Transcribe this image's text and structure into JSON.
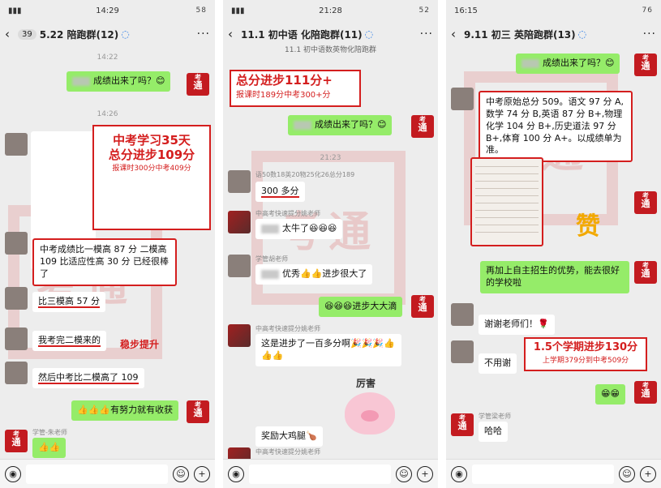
{
  "phones": [
    {
      "status": {
        "time": "14:29",
        "icons": "5G ▮▮ ◔",
        "battery": "58"
      },
      "nav": {
        "badge": "39",
        "title": "5.22 陪跑群(12)"
      },
      "timestamps": [
        "14:22",
        "14:26"
      ],
      "messages": {
        "m1": "成绩出来了吗？😊",
        "m2": "中考成绩比一模高 87 分 二模高 109 比适应性高 30 分 已经很棒了",
        "m3": "比三模高 57 分",
        "m4": "我考完二模来的",
        "m5": "然后中考比二模高了 109",
        "m6": "👍👍👍有努力就有收获",
        "m7": "👍👍"
      },
      "callout": {
        "line1": "中考学习35天",
        "line2": "总分进步109分",
        "line3": "报课时300分中考409分"
      },
      "tag": "稳步提升",
      "sender_label": "学管-朱老师",
      "watermark": "考通"
    },
    {
      "status": {
        "time": "21:28",
        "icons": "5G ▮▮ ◔",
        "battery": "52"
      },
      "nav": {
        "title": "11.1 初中语 化陪跑群(11)",
        "subtitle": "11.1 初中语数英物化陪跑群"
      },
      "timestamps": [
        "21:23"
      ],
      "callout": {
        "line1": "总分进步111分+",
        "line2": "报课时189分中考300+分"
      },
      "messages": {
        "m1": "成绩出来了吗？😊",
        "m2": "语50数18英20物25化26总分189",
        "m3": "300 多分",
        "m4": "太牛了😆😆😆",
        "m5": "优秀👍👍进步很大了",
        "m6": "😆😆😆进步大大滴",
        "m7": "这是进步了一百多分啊🎉🎉🎉👍👍👍",
        "m8": "奖励大鸡腿🍗"
      },
      "senders": [
        "中高考快速提分姚老师",
        "学管胡老师",
        "中高考快速提分姚老师",
        "中高考快速提分姚老师"
      ],
      "sticker_text": "厉害",
      "watermark": "考通"
    },
    {
      "status": {
        "time": "16:15",
        "icons": "0.90 KB/s ▮▮ 76%",
        "battery": "76"
      },
      "nav": {
        "title": "9.11 初三 英陪跑群(13)"
      },
      "messages": {
        "m1": "成绩出来了吗？😊",
        "m2": "中考原始总分 509。语文 97 分 A,数学 74 分 B,英语 87 分 B+,物理化学 104 分 B+,历史道法 97 分 B+,体育 100 分 A+。以成绩单为准。",
        "m3": "再加上自主招生的优势，能去很好的学校啦",
        "m4": "谢谢老师们！🌹",
        "m5": "不用谢",
        "m6": "😁😁",
        "m7": "哈哈"
      },
      "callout": {
        "line1": "1.5个学期进步130分",
        "line2": "上学期379分到中考509分"
      },
      "sender_label": "学管梁老师",
      "zan": "赞",
      "watermark": "考通"
    }
  ],
  "avatar_text": {
    "top": "考",
    "mid": "通"
  }
}
